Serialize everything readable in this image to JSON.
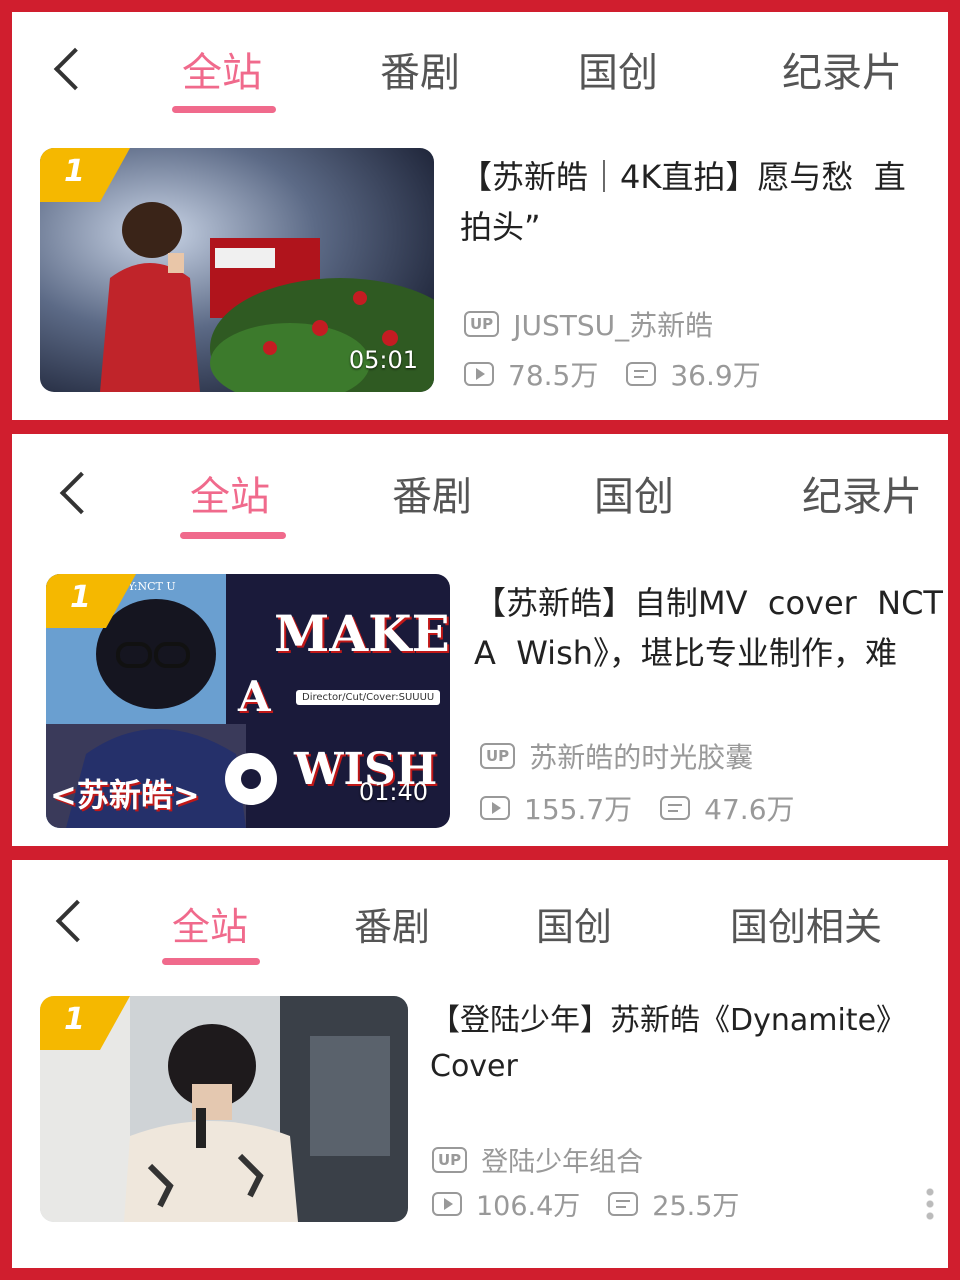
{
  "panels": [
    {
      "tabs": [
        "全站",
        "番剧",
        "国创",
        "纪录片"
      ],
      "active_tab": 0,
      "video": {
        "rank": "1",
        "duration": "05:01",
        "title": "【苏新皓｜4K直拍】愿与愁  直拍头”",
        "uploader": "JUSTSU_苏新皓",
        "views": "78.5万",
        "danmaku": "36.9万"
      }
    },
    {
      "tabs": [
        "全站",
        "番剧",
        "国创",
        "纪录片"
      ],
      "active_tab": 0,
      "video": {
        "rank": "1",
        "duration": "01:40",
        "title": "【苏新皓】自制MV  cover  NCT  A  Wish》，堪比专业制作，难",
        "uploader": "苏新皓的时光胶囊",
        "views": "155.7万",
        "danmaku": "47.6万",
        "thumb_text": {
          "line1": "MAKE",
          "line2": "A",
          "line3": "WISH",
          "name": "<苏新皓>",
          "credit": "Director/Cut/Cover:SUUUU",
          "by": "BY:NCT U"
        }
      }
    },
    {
      "tabs": [
        "全站",
        "番剧",
        "国创",
        "国创相关"
      ],
      "active_tab": 0,
      "video": {
        "rank": "1",
        "duration": "",
        "title": "【登陆少年】苏新皓《Dynamite》Cover",
        "uploader": "登陆少年组合",
        "views": "106.4万",
        "danmaku": "25.5万"
      }
    }
  ],
  "icons": {
    "up": "UP",
    "back": "chevron-left-icon",
    "play": "play-count-icon",
    "danmaku": "danmaku-icon",
    "more": "more-vertical-icon"
  },
  "colors": {
    "frame": "#d01e2e",
    "accent": "#f06a8c",
    "rank_badge": "#f5b800"
  }
}
